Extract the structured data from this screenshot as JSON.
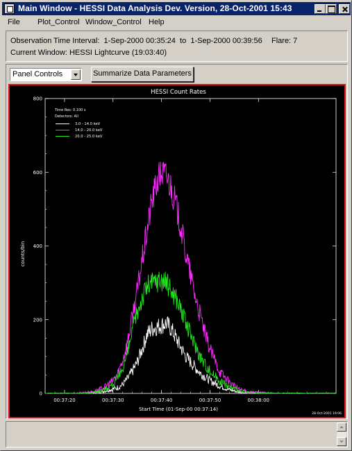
{
  "window": {
    "title": "Main Window - HESSI Data Analysis Dev. Version, 28-Oct-2001 15:43"
  },
  "menu": [
    "File",
    "Plot_Control",
    "Window_Control",
    "Help"
  ],
  "info": {
    "interval_label": "Observation Time Interval:",
    "interval_start": "1-Sep-2000 00:35:24",
    "interval_to": "to",
    "interval_end": "1-Sep-2000 00:39:56",
    "flare": "Flare: 7",
    "current_window": "Current Window: HESSI Lightcurve (19:03:40)"
  },
  "controls": {
    "panel_select": "Panel Controls",
    "summarize_button": "Summarize Data Parameters"
  },
  "colors": {
    "plot_border": "#e0121a",
    "series_low": "#ffffff",
    "series_mid": "#ff2cff",
    "series_high": "#22e81e"
  },
  "chart_data": {
    "type": "line",
    "title": "HESSI Count Rates",
    "xlabel": "Start Time (01-Sep-00 00:37:14)",
    "ylabel": "counts/bin",
    "xlim": [
      2,
      62
    ],
    "ylim": [
      0,
      800
    ],
    "x_ticks": [
      {
        "value": 6,
        "label": "00:37:20"
      },
      {
        "value": 16,
        "label": "00:37:30"
      },
      {
        "value": 26,
        "label": "00:37:40"
      },
      {
        "value": 36,
        "label": "00:37:50"
      },
      {
        "value": 46,
        "label": "00:38:00"
      }
    ],
    "y_ticks": [
      0,
      200,
      400,
      600,
      800
    ],
    "annotations": {
      "time_res": "Time Res: 0.100 s",
      "detectors": "Detectors: All",
      "timestamp": "28-Oct-2001 19:06"
    },
    "series": [
      {
        "name": "3.0 - 14.0 keV",
        "color": "#ffffff",
        "x": [
          10,
          12,
          14,
          16,
          17,
          18,
          19,
          20,
          21,
          22,
          23,
          24,
          25,
          26,
          27,
          28,
          29,
          30,
          31,
          32,
          33,
          34,
          35,
          36,
          38,
          40,
          42,
          44,
          50
        ],
        "y": [
          0,
          2,
          6,
          12,
          16,
          24,
          40,
          60,
          85,
          120,
          160,
          175,
          180,
          185,
          190,
          175,
          150,
          125,
          100,
          85,
          70,
          55,
          45,
          35,
          20,
          10,
          4,
          1,
          0
        ]
      },
      {
        "name": "14.0 - 20.0 keV",
        "color": "#ff2cff",
        "x": [
          8,
          12,
          14,
          16,
          17,
          18,
          19,
          20,
          21,
          22,
          23,
          24,
          25,
          26,
          27,
          28,
          29,
          30,
          31,
          32,
          33,
          34,
          35,
          36,
          37,
          38,
          40,
          42,
          44,
          50
        ],
        "y": [
          0,
          5,
          15,
          35,
          55,
          90,
          140,
          210,
          280,
          360,
          440,
          520,
          570,
          600,
          590,
          560,
          510,
          450,
          380,
          320,
          260,
          210,
          160,
          120,
          90,
          60,
          30,
          12,
          4,
          0
        ]
      },
      {
        "name": "20.0 - 25.0 keV",
        "color": "#22e81e",
        "x": [
          10,
          12,
          14,
          16,
          17,
          18,
          19,
          20,
          21,
          22,
          23,
          24,
          25,
          26,
          27,
          28,
          29,
          30,
          31,
          32,
          33,
          34,
          35,
          36,
          38,
          40,
          42,
          44,
          50
        ],
        "y": [
          0,
          3,
          10,
          25,
          40,
          70,
          110,
          170,
          220,
          260,
          290,
          300,
          305,
          310,
          300,
          280,
          260,
          230,
          190,
          160,
          130,
          100,
          80,
          60,
          35,
          18,
          7,
          2,
          0
        ]
      }
    ]
  }
}
